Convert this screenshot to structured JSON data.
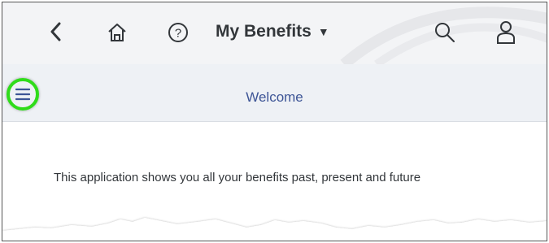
{
  "shell": {
    "back_icon": "chevron-left-icon",
    "home_icon": "home-icon",
    "help_icon": "help-circle-icon",
    "app_title": "My Benefits",
    "app_title_caret": "▼",
    "search_icon": "search-icon",
    "user_icon": "user-icon"
  },
  "subheader": {
    "menu_icon": "hamburger-menu-icon",
    "title": "Welcome",
    "highlight_color": "#2fdc1a"
  },
  "content": {
    "description": "This application shows you all your benefits past, present and future"
  },
  "colors": {
    "title_blue": "#3d5596",
    "shell_bg": "#f3f4f6",
    "subheader_bg": "#eef1f5"
  }
}
